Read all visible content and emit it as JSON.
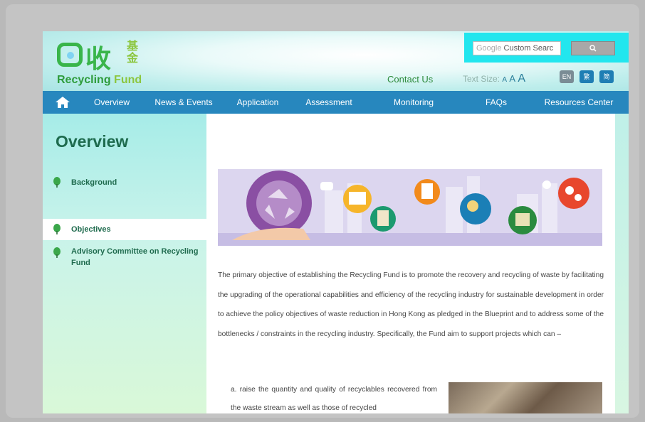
{
  "logo": {
    "chinese": "收",
    "chinese_small": "基金",
    "english_main": "Recycling",
    "english_accent": "Fund"
  },
  "search": {
    "placeholder_prefix": "Google",
    "value": "Custom Searc",
    "button_icon": "search-icon"
  },
  "header": {
    "contact_us": "Contact Us",
    "text_size_label": "Text Size:",
    "text_size_options": [
      "A",
      "A",
      "A"
    ],
    "languages": [
      "EN",
      "繁",
      "简"
    ]
  },
  "nav": {
    "home_icon": "home-icon",
    "items": [
      "Overview",
      "News & Events",
      "Application",
      "Assessment",
      "Monitoring",
      "FAQs",
      "Resources Center"
    ]
  },
  "sidebar": {
    "title": "Overview",
    "items": [
      {
        "label": "Background",
        "active": false,
        "icon": "tree-icon"
      },
      {
        "label": "Objectives",
        "active": true,
        "icon": "tree-icon"
      },
      {
        "label": "Advisory Committee on Recycling Fund",
        "active": false,
        "icon": "tree-icon"
      }
    ]
  },
  "main": {
    "paragraph": "The primary objective of establishing the Recycling Fund is to promote the recovery and recycling of waste by facilitating the upgrading of the operational capabilities and efficiency of the recycling industry for sustainable development in order to achieve the policy objectives of waste reduction in Hong Kong as pledged in the Blueprint and to address some of the bottlenecks / constraints in the recycling industry. Specifically, the Fund aim to support projects which can –",
    "list_item_a": "a. raise the quantity and quality of recyclables recovered from the waste stream as well as those of recycled"
  },
  "colors": {
    "nav": "#2787be",
    "brand_green": "#39b54a",
    "search_highlight": "#22e6ee",
    "sidebar_text": "#1e6b4e"
  }
}
